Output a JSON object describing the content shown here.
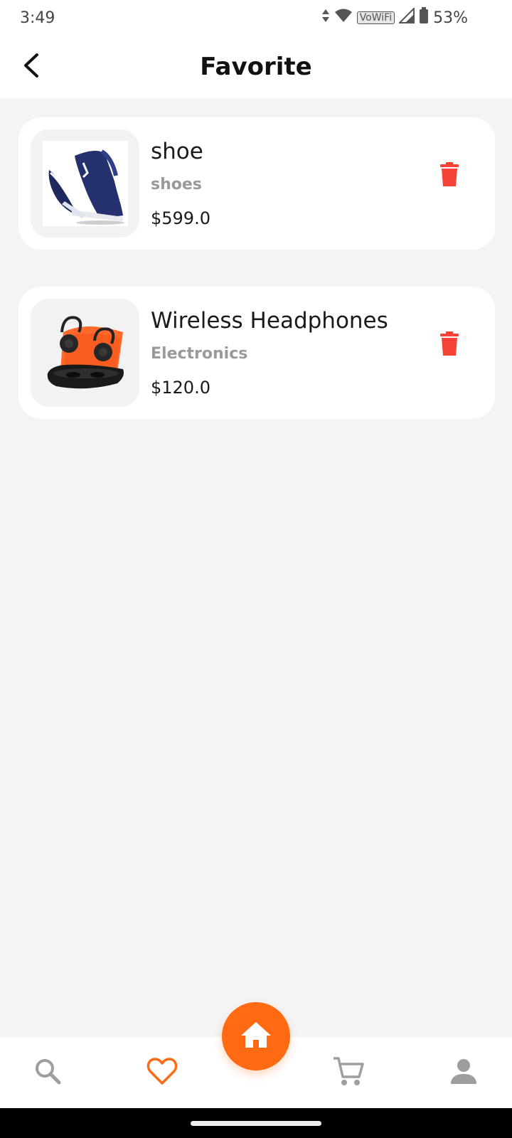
{
  "status_bar": {
    "time": "3:49",
    "vowifi_label": "VoWiFi",
    "battery": "53%",
    "icons": [
      "data-arrows-icon",
      "wifi-icon",
      "signal-icon",
      "battery-icon"
    ]
  },
  "header": {
    "title": "Favorite",
    "back_icon": "chevron-left-icon"
  },
  "favorites": [
    {
      "name": "shoe",
      "category": "shoes",
      "price": "$599.0",
      "image": "sneaker-image",
      "delete_icon": "trash-icon"
    },
    {
      "name": "Wireless Headphones",
      "category": "Electronics",
      "price": "$120.0",
      "image": "earbuds-image",
      "delete_icon": "trash-icon"
    }
  ],
  "bottom_nav": {
    "items": [
      {
        "icon": "search-icon",
        "active": false
      },
      {
        "icon": "heart-icon",
        "active": true
      },
      {
        "icon": "home-icon",
        "active": false
      },
      {
        "icon": "cart-icon",
        "active": false
      },
      {
        "icon": "person-icon",
        "active": false
      }
    ]
  },
  "colors": {
    "accent": "#ff6a13",
    "delete": "#f44336",
    "muted_icon": "#9e9e9e",
    "background": "#f4f4f4"
  }
}
